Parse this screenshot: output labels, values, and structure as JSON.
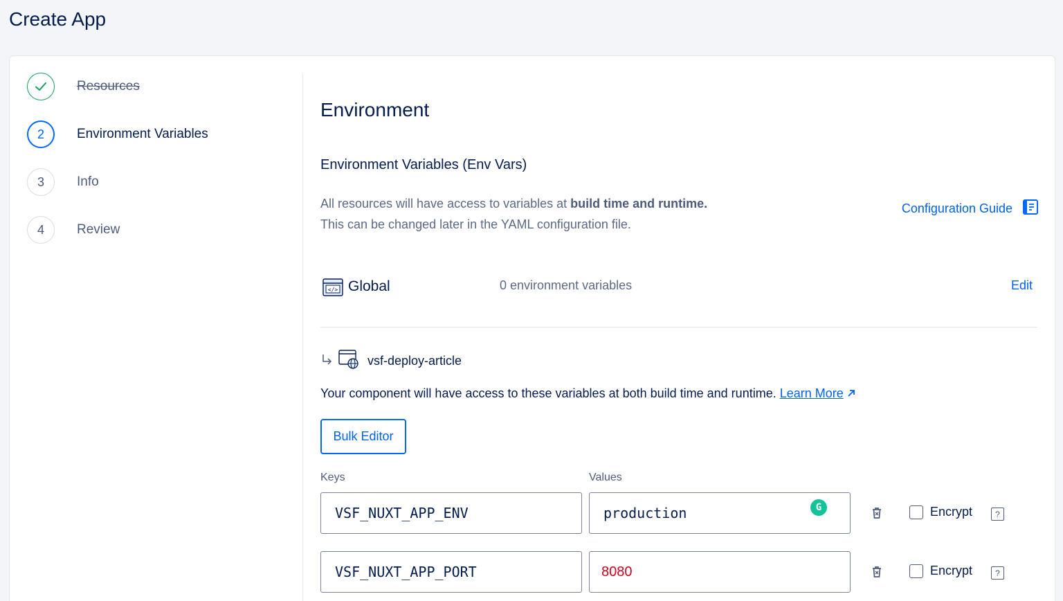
{
  "header": {
    "title": "Create App"
  },
  "stepper": {
    "steps": [
      {
        "number": "",
        "label": "Resources",
        "state": "done"
      },
      {
        "number": "2",
        "label": "Environment Variables",
        "state": "active"
      },
      {
        "number": "3",
        "label": "Info",
        "state": "pending"
      },
      {
        "number": "4",
        "label": "Review",
        "state": "pending"
      }
    ]
  },
  "main": {
    "title": "Environment",
    "section_title": "Environment Variables (Env Vars)",
    "description_prefix": "All resources will have access to variables at ",
    "description_bold": "build time and runtime.",
    "description_line2": "This can be changed later in the YAML configuration file.",
    "config_guide": "Configuration Guide",
    "global": {
      "name": "Global",
      "count": "0 environment variables",
      "edit": "Edit"
    },
    "component": {
      "name": "vsf-deploy-article",
      "description": "Your component will have access to these variables at both build time and runtime. ",
      "learn_more": "Learn More",
      "bulk_editor": "Bulk Editor",
      "keys_label": "Keys",
      "values_label": "Values",
      "encrypt_label": "Encrypt",
      "help": "?",
      "rows": [
        {
          "key": "VSF_NUXT_APP_ENV",
          "value": "production"
        },
        {
          "key": "VSF_NUXT_APP_PORT",
          "value": "8080"
        }
      ]
    }
  },
  "colors": {
    "accent": "#0069ff",
    "done": "#15a05b",
    "text": "#031b4e",
    "error": "#d0021b"
  }
}
